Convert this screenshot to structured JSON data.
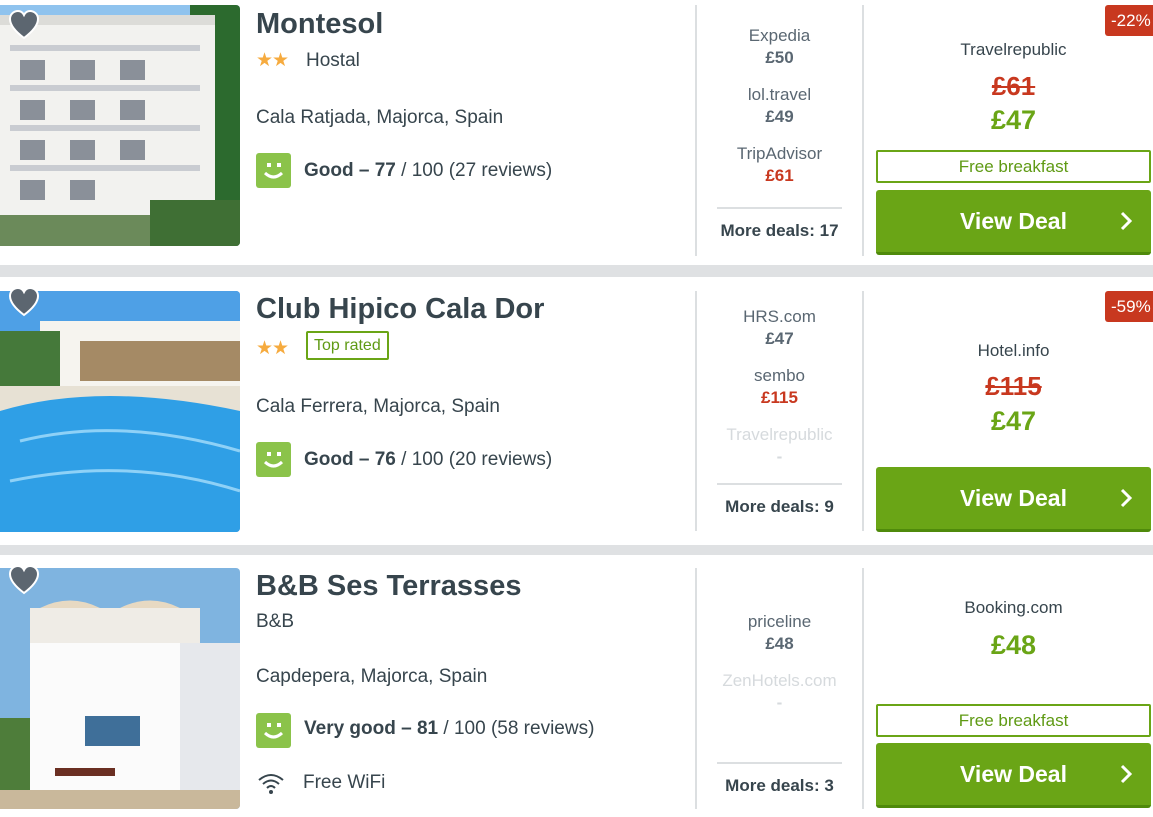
{
  "colors": {
    "accent_green": "#6aa516",
    "discount_red": "#c8381f",
    "star": "#f6ab3f",
    "rating_green": "#8bc34a"
  },
  "hotels": [
    {
      "name": "Montesol",
      "stars": "★★",
      "hotel_type": "Hostal",
      "location": "Cala Ratjada, Majorca, Spain",
      "rating_label": "Good",
      "rating_dash": " – ",
      "rating_score": "77",
      "rating_suffix": " / 100 (27 reviews)",
      "deals": [
        {
          "provider": "Expedia",
          "price": "£50"
        },
        {
          "provider": "lol.travel",
          "price": "£49"
        },
        {
          "provider": "TripAdvisor",
          "price": "£61"
        }
      ],
      "more_deals": "More deals: 17",
      "discount": "-22%",
      "best_provider": "Travelrepublic",
      "old_price": "£61",
      "best_price": "£47",
      "perk": "Free breakfast",
      "cta": "View Deal"
    },
    {
      "name": "Club Hipico Cala Dor",
      "stars": "★★",
      "badge": "Top rated",
      "location": "Cala Ferrera, Majorca, Spain",
      "rating_label": "Good",
      "rating_dash": " – ",
      "rating_score": "76",
      "rating_suffix": " / 100 (20 reviews)",
      "deals": [
        {
          "provider": "HRS.com",
          "price": "£47"
        },
        {
          "provider": "sembo",
          "price": "£115"
        },
        {
          "provider": "Travelrepublic",
          "price": "-"
        }
      ],
      "more_deals": "More deals: 9",
      "discount": "-59%",
      "best_provider": "Hotel.info",
      "old_price": "£115",
      "best_price": "£47",
      "cta": "View Deal"
    },
    {
      "name": "B&B Ses Terrasses",
      "hotel_type": "B&B",
      "location": "Capdepera, Majorca, Spain",
      "rating_label": "Very good",
      "rating_dash": " – ",
      "rating_score": "81",
      "rating_suffix": " / 100 (58 reviews)",
      "amenity": "Free WiFi",
      "deals": [
        {
          "provider": "priceline",
          "price": "£48"
        },
        {
          "provider": "ZenHotels.com",
          "price": "-"
        }
      ],
      "more_deals": "More deals: 3",
      "best_provider": "Booking.com",
      "best_price": "£48",
      "perk": "Free breakfast",
      "cta": "View Deal"
    }
  ]
}
